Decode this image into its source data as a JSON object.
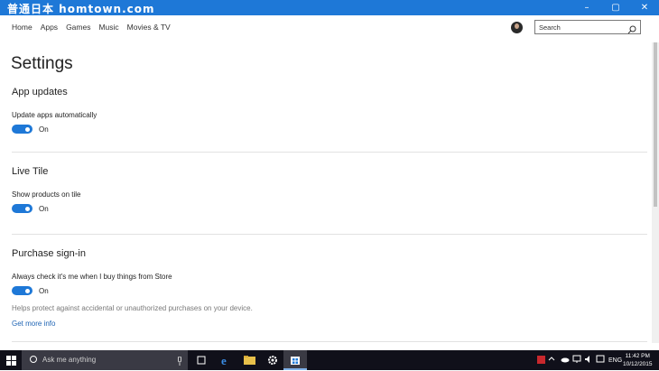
{
  "window": {
    "watermark": "普通日本 homtown.com",
    "controls": {
      "minimize": "–",
      "restore": "▢",
      "close": "✕"
    }
  },
  "nav": {
    "items": [
      "Home",
      "Apps",
      "Games",
      "Music",
      "Movies & TV"
    ]
  },
  "search": {
    "placeholder": "Search"
  },
  "page_title": "Settings",
  "sections": {
    "app_updates": {
      "heading": "App updates",
      "label": "Update apps automatically",
      "state": "On"
    },
    "live_tile": {
      "heading": "Live Tile",
      "label": "Show products on tile",
      "state": "On"
    },
    "purchase": {
      "heading": "Purchase sign-in",
      "label": "Always check it's me when I buy things from Store",
      "state": "On",
      "note": "Helps protect against accidental or unauthorized purchases on your device.",
      "link": "Get more info"
    }
  },
  "taskbar": {
    "search_placeholder": "Ask me anything",
    "language": "ENG",
    "time": "11:42 PM",
    "date": "10/12/2015",
    "icons": [
      "windows-logo-icon",
      "task-view-icon",
      "edge-icon",
      "file-explorer-icon",
      "settings-gear-icon",
      "store-icon"
    ]
  },
  "colors": {
    "accent": "#1e78d7",
    "taskbar": "#10101a",
    "link": "#1e64b4"
  }
}
